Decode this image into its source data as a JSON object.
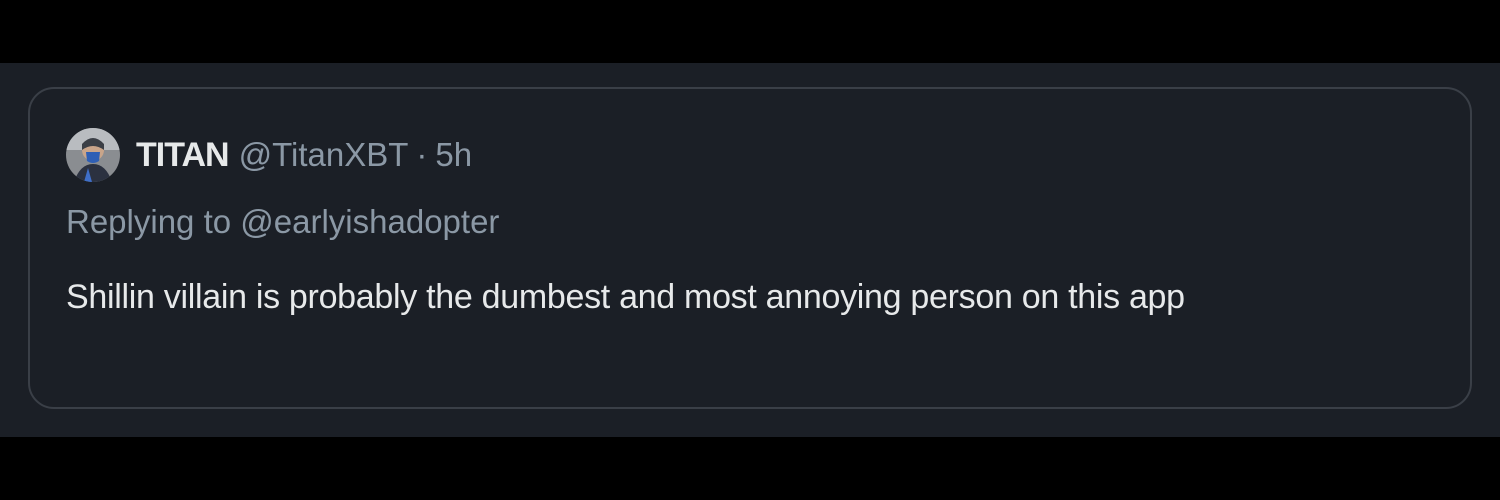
{
  "tweet": {
    "display_name": "TITAN",
    "handle": "@TitanXBT",
    "separator": "·",
    "time": "5h",
    "replying_prefix": "Replying to",
    "replying_to": "@earlyishadopter",
    "text": "Shillin villain is probably the dumbest and most annoying person on this app"
  },
  "colors": {
    "background": "#1b1f26",
    "border": "#3a3f47",
    "primary_text": "#e7e9ea",
    "secondary_text": "#8b98a5"
  }
}
